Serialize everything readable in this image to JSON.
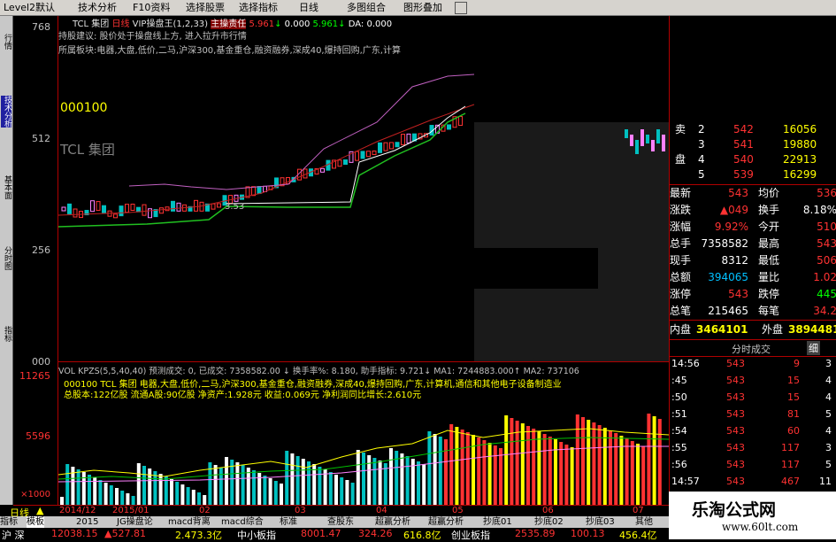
{
  "menu": [
    "Level2默认",
    "技术分析",
    "F10资料",
    "选择股票",
    "选择指标",
    "日线",
    "多图组合",
    "图形叠加"
  ],
  "menu_icon": "window-icon",
  "chart_header": {
    "code_name": "TCL 集团",
    "period": "日线",
    "indicator": "VIP操盘王(1,2,33)",
    "ind_name": "主操责任",
    "v1": "5.961",
    "arrow1": "↓",
    "v2": "0.000",
    "v3": "5.961",
    "arrow2": "↓",
    "da": "DA: 0.000"
  },
  "chart_notes": {
    "line1": "持股建议: 股价处于操盘线上方, 进入拉升市行情",
    "line2": "所属板块:电器,大盘,低价,二马,沪深300,基金重仓,融资融券,深成40,爆持回购,广东,计算"
  },
  "overlay": {
    "code": "000100",
    "name": "TCL 集团",
    "low_mark": "3.53"
  },
  "price_axis": [
    "768",
    "512",
    "256",
    "000"
  ],
  "vol_axis": [
    "11265",
    "5596"
  ],
  "vol_header": {
    "line1": "VOL KPZS(5,5,40,40) 预测成交: 0, 已成交: 7358582.00 ↓ 换手率%: 8.180, 助手指标: 9.721↓ MA1: 7244883.000↑ MA2: 737106",
    "line2": "000100 TCL 集团 电器,大盘,低价,二马,沪深300,基金重仓,融资融券,深成40,爆持回购,广东,计算机,通信和其他电子设备制造业",
    "line3": "总股本:122亿股 流通A股:90亿股 净资产:1.928元 收益:0.069元 净利润同比增长:2.610元"
  },
  "left_tabs": [
    "行情",
    "技术分析",
    "基本面",
    "分时图",
    "指标"
  ],
  "quote": {
    "orderbook": [
      {
        "label": "卖",
        "level": "2",
        "price": "542",
        "vol": "16056"
      },
      {
        "label": "",
        "level": "3",
        "price": "541",
        "vol": "19880"
      },
      {
        "label": "盘",
        "level": "4",
        "price": "540",
        "vol": "22913"
      },
      {
        "label": "",
        "level": "5",
        "price": "539",
        "vol": "16299"
      }
    ],
    "stats": [
      {
        "l1": "最新",
        "v1": "543",
        "l2": "均价",
        "v2": "536"
      },
      {
        "l1": "涨跌",
        "v1": "▲049",
        "l2": "换手",
        "v2": "8.18%"
      },
      {
        "l1": "涨幅",
        "v1": "9.92%",
        "l2": "今开",
        "v2": "510"
      },
      {
        "l1": "总手",
        "v1": "7358582",
        "l2": "最高",
        "v2": "543"
      },
      {
        "l1": "现手",
        "v1": "8312",
        "l2": "最低",
        "v2": "506"
      },
      {
        "l1": "总额",
        "v1": "394065",
        "l2": "量比",
        "v2": "1.02"
      },
      {
        "l1": "涨停",
        "v1": "543",
        "l2": "跌停",
        "v2": "445"
      },
      {
        "l1": "总笔",
        "v1": "215465",
        "l2": "每笔",
        "v2": "34.2"
      }
    ],
    "inner_label": "内盘",
    "inner_val": "3464101",
    "outer_label": "外盘",
    "outer_val": "3894481",
    "ticks_title": "分时成交",
    "ticks_toggle": "细",
    "ticks": [
      {
        "t": "14:56",
        "p": "543",
        "v": "9",
        "n": "3"
      },
      {
        "t": ":45",
        "p": "543",
        "v": "15",
        "n": "4"
      },
      {
        "t": ":50",
        "p": "543",
        "v": "15",
        "n": "4"
      },
      {
        "t": ":51",
        "p": "543",
        "v": "81",
        "n": "5"
      },
      {
        "t": ":54",
        "p": "543",
        "v": "60",
        "n": "4"
      },
      {
        "t": ":55",
        "p": "543",
        "v": "117",
        "n": "3"
      },
      {
        "t": ":56",
        "p": "543",
        "v": "117",
        "n": "5"
      },
      {
        "t": "14:57",
        "p": "543",
        "v": "467",
        "n": "11"
      }
    ]
  },
  "bottom_axis": {
    "period_label": "日线",
    "period_marker": "▲",
    "xscale": "×1000",
    "dates": [
      "2014/12",
      "2015/01",
      "02",
      "03",
      "04",
      "05",
      "06",
      "07"
    ]
  },
  "tabs": [
    "指标",
    "模板",
    "2015",
    "JG操盘论",
    "macd背离",
    "macd综合",
    "标准",
    "查股东",
    "超赢分析",
    "超赢分析",
    "抄底01",
    "抄底02",
    "抄底03",
    "其他"
  ],
  "ticker": [
    "沪 深",
    "12038.15",
    "▲527.81",
    "2.473.3亿",
    "中小板指",
    "8001.47",
    "324.26",
    "616.8亿",
    "创业板指",
    "2535.89",
    "100.13",
    "456.4亿"
  ],
  "watermark": {
    "title": "乐淘公式网",
    "url": "www.60lt.com"
  },
  "colors": {
    "up": "#ff3232",
    "down": "#00c0c0",
    "white": "#ffffff",
    "yellow": "#ffff00",
    "green": "#00ff00",
    "violet": "#ff80ff"
  }
}
